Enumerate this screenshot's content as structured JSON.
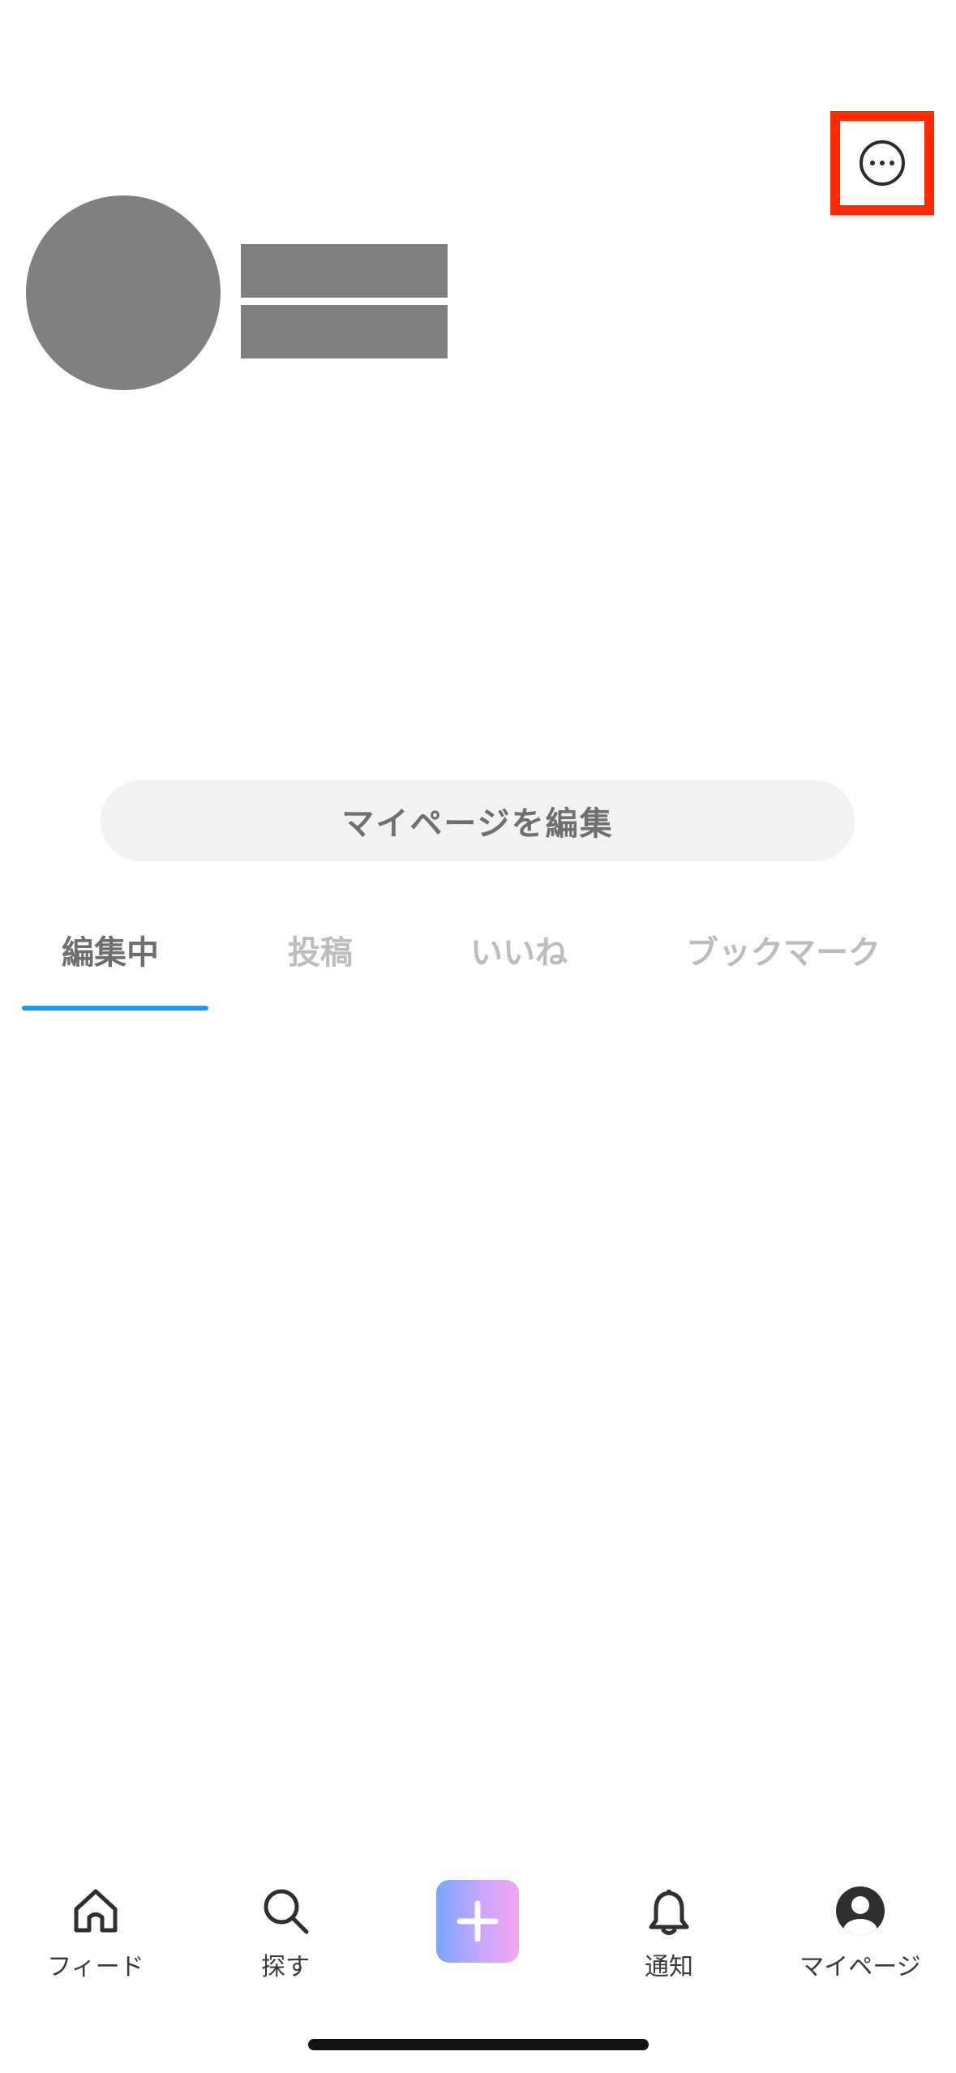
{
  "profile": {
    "edit_label": "マイページを編集"
  },
  "tabs": [
    {
      "label": "編集中",
      "active": true
    },
    {
      "label": "投稿",
      "active": false
    },
    {
      "label": "いいね",
      "active": false
    },
    {
      "label": "ブックマーク",
      "active": false
    }
  ],
  "bottom_nav": {
    "feed_label": "フィード",
    "explore_label": "探す",
    "notify_label": "通知",
    "mypage_label": "マイページ"
  },
  "colors": {
    "accent": "#1e9bf0",
    "highlight": "#ff2a00",
    "placeholder": "#808080"
  },
  "icons": {
    "more": "more-horizontal-circle-icon",
    "feed": "home-icon",
    "explore": "search-icon",
    "post": "plus-icon",
    "notify": "bell-icon",
    "mypage": "user-circle-icon"
  }
}
